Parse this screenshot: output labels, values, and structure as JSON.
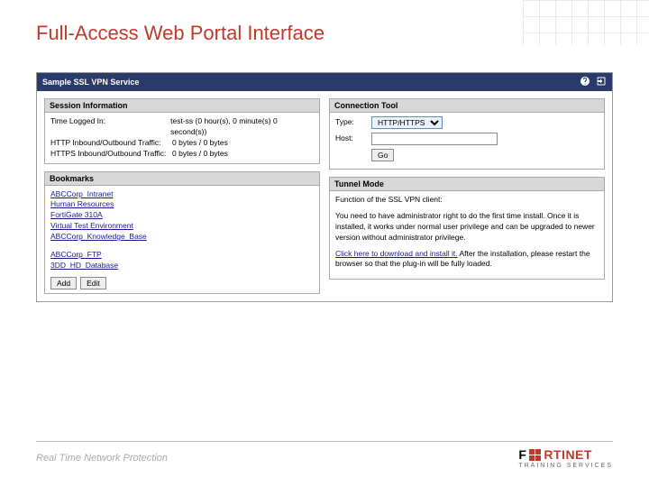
{
  "slide": {
    "title": "Full-Access Web Portal Interface"
  },
  "portal": {
    "service_name": "Sample SSL VPN Service",
    "session": {
      "header": "Session Information",
      "rows": [
        {
          "label": "Time Logged In:",
          "value": "test-ss (0 hour(s), 0 minute(s) 0 second(s))"
        },
        {
          "label": "HTTP Inbound/Outbound Traffic:",
          "value": "0 bytes / 0 bytes"
        },
        {
          "label": "HTTPS Inbound/Outbound Traffic:",
          "value": "0 bytes / 0 bytes"
        }
      ]
    },
    "bookmarks": {
      "header": "Bookmarks",
      "web": [
        "ABCCorp_Intranet",
        "Human Resources",
        "FortiGate 310A",
        "Virtual Test Environment",
        "ABCCorp_Knowledge_Base"
      ],
      "other": [
        "ABCCorp_FTP",
        "3DD_HD_Database"
      ],
      "add_label": "Add",
      "edit_label": "Edit"
    },
    "connection_tool": {
      "header": "Connection Tool",
      "type_label": "Type:",
      "type_value": "HTTP/HTTPS",
      "host_label": "Host:",
      "host_value": "",
      "go_label": "Go"
    },
    "tunnel": {
      "header": "Tunnel Mode",
      "intro": "Function of the SSL VPN client:",
      "desc": "You need to have administrator right to do the first time install. Once it is installed, it works under normal user privilege and can be upgraded to newer version without administrator privilege.",
      "link_text": "Click here to download and install it.",
      "after_text": " After the installation, please restart the browser so that the plug-in will be fully loaded."
    }
  },
  "footer": {
    "tagline": "Real Time Network Protection",
    "brand_1": "F",
    "brand_2": "RTINET",
    "sub": "TRAINING SERVICES"
  }
}
